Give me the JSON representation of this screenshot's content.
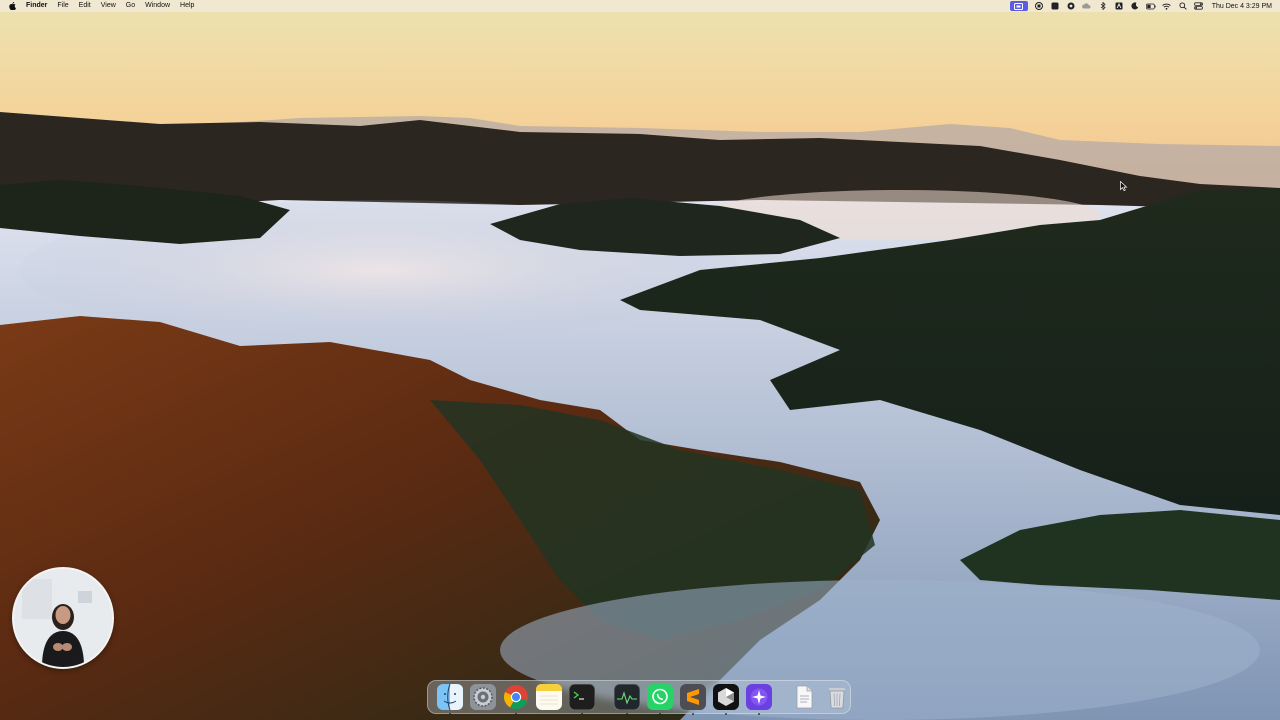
{
  "menubar": {
    "app_name": "Finder",
    "menus": [
      "File",
      "Edit",
      "View",
      "Go",
      "Window",
      "Help"
    ],
    "clock": "Thu Dec 4  3:29 PM",
    "tray_icons": [
      "screen-recording-icon",
      "stop-icon",
      "display-icon",
      "shield-icon",
      "cloud-icon",
      "bluetooth-icon",
      "text-input-icon",
      "focus-moon-icon",
      "battery-icon",
      "wifi-icon",
      "spotlight-search-icon",
      "control-center-icon"
    ]
  },
  "dock": {
    "apps": [
      {
        "name": "Finder",
        "icon": "finder-icon",
        "running": true
      },
      {
        "name": "System Settings",
        "icon": "settings-gear-icon",
        "running": false
      },
      {
        "name": "Google Chrome",
        "icon": "chrome-icon",
        "running": true
      },
      {
        "name": "Notes",
        "icon": "notes-icon",
        "running": false
      },
      {
        "name": "Terminal",
        "icon": "terminal-icon",
        "running": true
      },
      {
        "name": "Activity Monitor",
        "icon": "activity-monitor-icon",
        "running": true
      },
      {
        "name": "WhatsApp",
        "icon": "whatsapp-icon",
        "running": true
      },
      {
        "name": "Sublime Text",
        "icon": "sublime-text-icon",
        "running": true
      },
      {
        "name": "Cursor",
        "icon": "cursor-app-icon",
        "running": true
      },
      {
        "name": "Perplexity",
        "icon": "perplexity-icon",
        "running": true
      }
    ],
    "trailing": [
      {
        "name": "Document",
        "icon": "document-icon"
      },
      {
        "name": "Trash",
        "icon": "trash-icon"
      }
    ]
  },
  "colors": {
    "sky_top": "#e9d9a8",
    "sky_horizon": "#f5c98a",
    "fog": "#c9d6e8",
    "accent_tray": "#5b5ce2"
  }
}
